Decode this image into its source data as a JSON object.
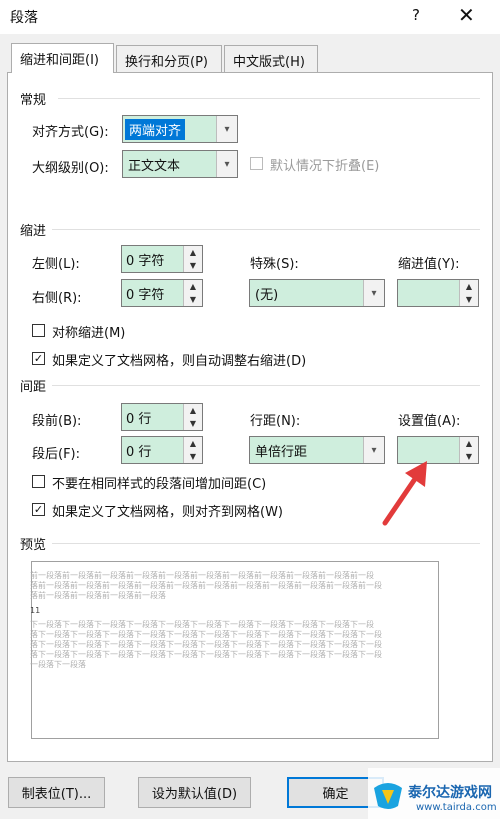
{
  "window": {
    "title": "段落",
    "help": "?",
    "close": "✕"
  },
  "tabs": [
    {
      "label": "缩进和间距(I)"
    },
    {
      "label": "换行和分页(P)"
    },
    {
      "label": "中文版式(H)"
    }
  ],
  "general": {
    "title": "常规",
    "alignment_label": "对齐方式(G):",
    "alignment_value": "两端对齐",
    "outline_label": "大纲级别(O):",
    "outline_value": "正文文本",
    "collapse_label": "默认情况下折叠(E)"
  },
  "indent": {
    "title": "缩进",
    "left_label": "左侧(L):",
    "left_value": "0 字符",
    "right_label": "右侧(R):",
    "right_value": "0 字符",
    "special_label": "特殊(S):",
    "special_value": "(无)",
    "indent_value_label": "缩进值(Y):",
    "indent_value": "",
    "mirror_label": "对称缩进(M)",
    "mirror_checked": false,
    "auto_adjust_label": "如果定义了文档网格，则自动调整右缩进(D)",
    "auto_adjust_checked": true
  },
  "spacing": {
    "title": "间距",
    "before_label": "段前(B):",
    "before_value": "0 行",
    "after_label": "段后(F):",
    "after_value": "0 行",
    "line_label": "行距(N):",
    "line_value": "单倍行距",
    "at_label": "设置值(A):",
    "at_value": "",
    "no_space_label": "不要在相同样式的段落间增加间距(C)",
    "no_space_checked": false,
    "snap_label": "如果定义了文档网格，则对齐到网格(W)",
    "snap_checked": true
  },
  "preview": {
    "title": "预览",
    "prev_line1": "前一段落前一段落前一段落前一段落前一段落前一段落前一段落前一段落前一段落前一段落前一段",
    "prev_line2": "落前一段落前一段落前一段落前一段落前一段落前一段落前一段落前一段落前一段落前一段落前一段",
    "prev_line3": "落前一段落前一段落前一段落前一段落",
    "sample": "11",
    "next_line1": "下一段落下一段落下一段落下一段落下一段落下一段落下一段落下一段落下一段落下一段落下一段",
    "next_line2": "落下一段落下一段落下一段落下一段落下一段落下一段落下一段落下一段落下一段落下一段落下一段",
    "next_line3": "落下一段落下一段落下一段落下一段落下一段落下一段落下一段落下一段落下一段落下一段落下一段",
    "next_line4": "落下一段落下一段落下一段落下一段落下一段落下一段落下一段落下一段落下一段落下一段落下一段",
    "next_line5": "一段落下一段落"
  },
  "buttons": {
    "tabs": "制表位(T)...",
    "set_default": "设为默认值(D)",
    "ok": "确定"
  },
  "watermark": {
    "text": "泰尔达游戏网",
    "url": "www.tairda.com"
  },
  "colors": {
    "accent": "#0078d7",
    "field_fill": "#cfeedd",
    "arrow": "#e23b3b"
  }
}
